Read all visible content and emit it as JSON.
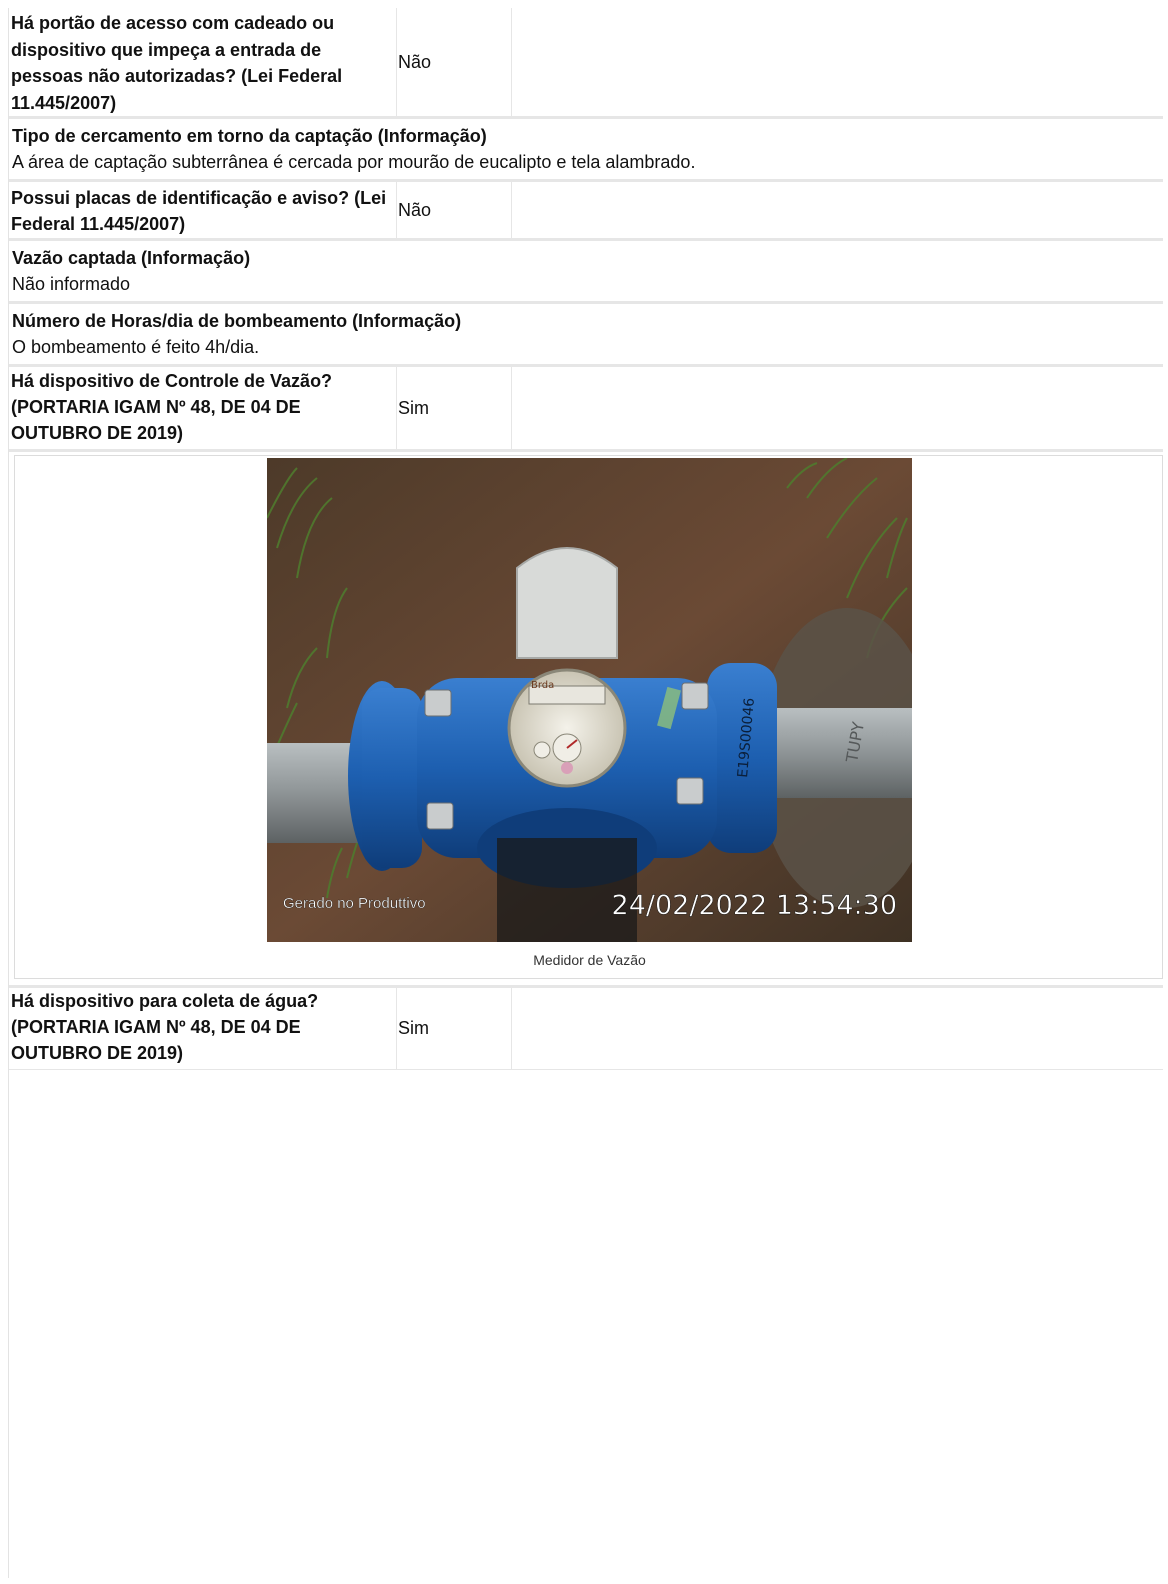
{
  "rows": [
    {
      "question": "Há portão de acesso com cadeado ou dispositivo que impeça a entrada de pessoas não autorizadas? (Lei Federal 11.445/2007)",
      "answer": "Não"
    },
    {
      "title": "Tipo de cercamento em torno da captação (Informação)",
      "body": "A área de captação subterrânea é cercada por mourão de eucalipto e tela alambrado."
    },
    {
      "question": "Possui placas de identificação e aviso? (Lei Federal 11.445/2007)",
      "answer": "Não"
    },
    {
      "title": "Vazão captada (Informação)",
      "body": "Não informado"
    },
    {
      "title": "Número de Horas/dia de bombeamento (Informação)",
      "body": "O bombeamento é feito 4h/dia."
    },
    {
      "question": "Há dispositivo de Controle de Vazão? (PORTARIA IGAM Nº 48, DE 04 DE OUTUBRO DE 2019)",
      "answer": "Sim"
    },
    {
      "question": "Há dispositivo para coleta de água? (PORTARIA IGAM Nº 48, DE 04 DE OUTUBRO DE 2019)",
      "answer": "Sim"
    }
  ],
  "photo": {
    "caption": "Medidor de Vazão",
    "stamp_app": "Gerado no Produttivo",
    "stamp_datetime": "24/02/2022 13:54:30",
    "meter_serial": "E19S00046",
    "pipe_brand": "TUPY",
    "meter_brand": "Brda"
  },
  "colors": {
    "meter_blue": "#1d5fb0",
    "pipe_gray": "#8e9496",
    "soil_brown": "#6b4a35",
    "grass_green": "#4f7a2e"
  }
}
